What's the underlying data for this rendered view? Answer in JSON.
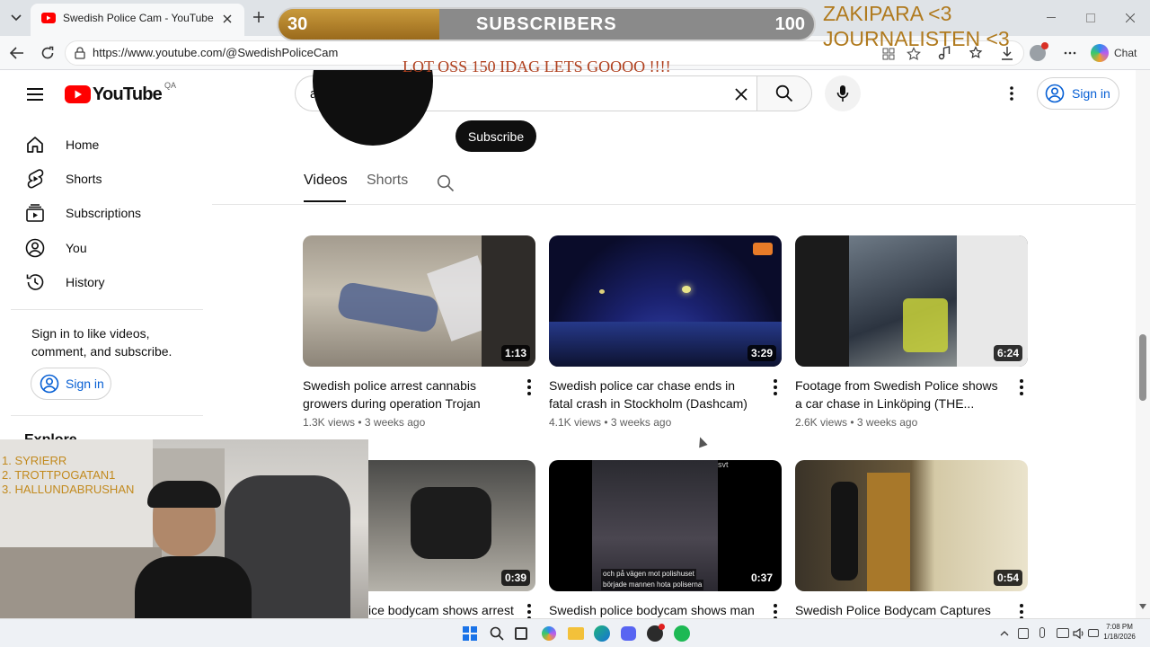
{
  "browser": {
    "tab_title": "Swedish Police Cam - YouTube",
    "url": "https://www.youtube.com/@SwedishPoliceCam",
    "chat_label": "Chat"
  },
  "overlay": {
    "sub_current": "30",
    "sub_label": "SUBSCRIBERS",
    "sub_goal": "100",
    "sub_progress": 0.3,
    "top_right_line1": "ZAKIPARA <3",
    "top_right_line2": "JOURNALISTEN <3",
    "banner": "LOT OSS 150 IDAG LETS GOOOO !!!!",
    "cam_list": [
      "1.  SYRIERR",
      "2.  TROTTPOGATAN1",
      "3.  HALLUNDABRUSHAN"
    ]
  },
  "youtube": {
    "region": "QA",
    "logo_text": "YouTube",
    "search_value": "asme",
    "sign_in_label": "Sign in",
    "subscribe_label": "Subscribe",
    "tabs": [
      "Videos",
      "Shorts"
    ],
    "active_tab": "Videos",
    "guide": [
      {
        "label": "Home",
        "icon": "home-icon"
      },
      {
        "label": "Shorts",
        "icon": "shorts-icon"
      },
      {
        "label": "Subscriptions",
        "icon": "subscriptions-icon"
      },
      {
        "label": "You",
        "icon": "you-icon"
      },
      {
        "label": "History",
        "icon": "history-icon"
      }
    ],
    "sign_in_prompt": "Sign in to like videos, comment, and subscribe.",
    "explore_label": "Explore",
    "videos": [
      {
        "title": "Swedish police arrest cannabis growers during operation Trojan Shiel...",
        "meta": "1.3K views • 3 weeks ago",
        "duration": "1:13"
      },
      {
        "title": "Swedish police car chase ends in fatal crash in Stockholm (Dashcam)",
        "meta": "4.1K views • 3 weeks ago",
        "duration": "3:29"
      },
      {
        "title": "Footage from Swedish Police shows a car chase in Linköping (THE...",
        "meta": "2.6K views • 3 weeks ago",
        "duration": "6:24"
      },
      {
        "title": "ice bodycam shows arrest",
        "meta": "",
        "duration": "0:39"
      },
      {
        "title": "Swedish police bodycam shows man",
        "meta": "",
        "duration": "0:37"
      },
      {
        "title": "Swedish Police Bodycam Captures",
        "meta": "",
        "duration": "0:54"
      }
    ],
    "subtitle_caption_line1": "och på vägen mot polishuset",
    "subtitle_caption_line2": "började mannen hota poliserna",
    "svt_logo": "svt"
  },
  "taskbar": {
    "time": "7:08 PM",
    "date": "1/18/2026"
  },
  "colors": {
    "youtube_red": "#ff0000",
    "link_blue": "#065fd4",
    "overlay_gold": "#b07a1e"
  }
}
